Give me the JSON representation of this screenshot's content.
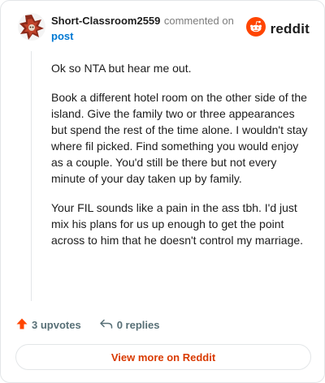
{
  "header": {
    "username": "Short-Classroom2559",
    "commented": "commented on",
    "post_link": "post",
    "brand": "reddit"
  },
  "comment": {
    "paragraphs": [
      "Ok so NTA but hear me out.",
      "Book a different hotel room on the other side of the island. Give the family two or three appearances but spend the rest of the time alone. I wouldn't stay where fil picked. Find something you would enjoy as a couple. You'd still be there but not every minute of your day taken up by family.",
      "Your FIL sounds like a pain in the ass tbh. I'd just mix his plans for us up enough to get the point across to him that he doesn't control my marriage."
    ]
  },
  "actions": {
    "upvotes": "3 upvotes",
    "replies": "0 replies"
  },
  "view_more": "View more on Reddit",
  "colors": {
    "accent": "#d93a00",
    "link": "#0079d3",
    "upvote": "#ff4500"
  }
}
